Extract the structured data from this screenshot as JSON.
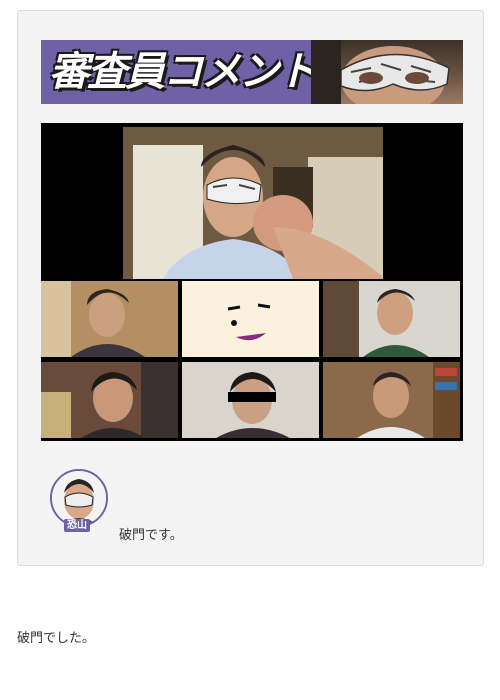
{
  "banner": {
    "title": "審査員コメント"
  },
  "avatar": {
    "name": "恐山"
  },
  "comment": {
    "text": "破門です。"
  },
  "post": {
    "text": "破門でした。"
  }
}
